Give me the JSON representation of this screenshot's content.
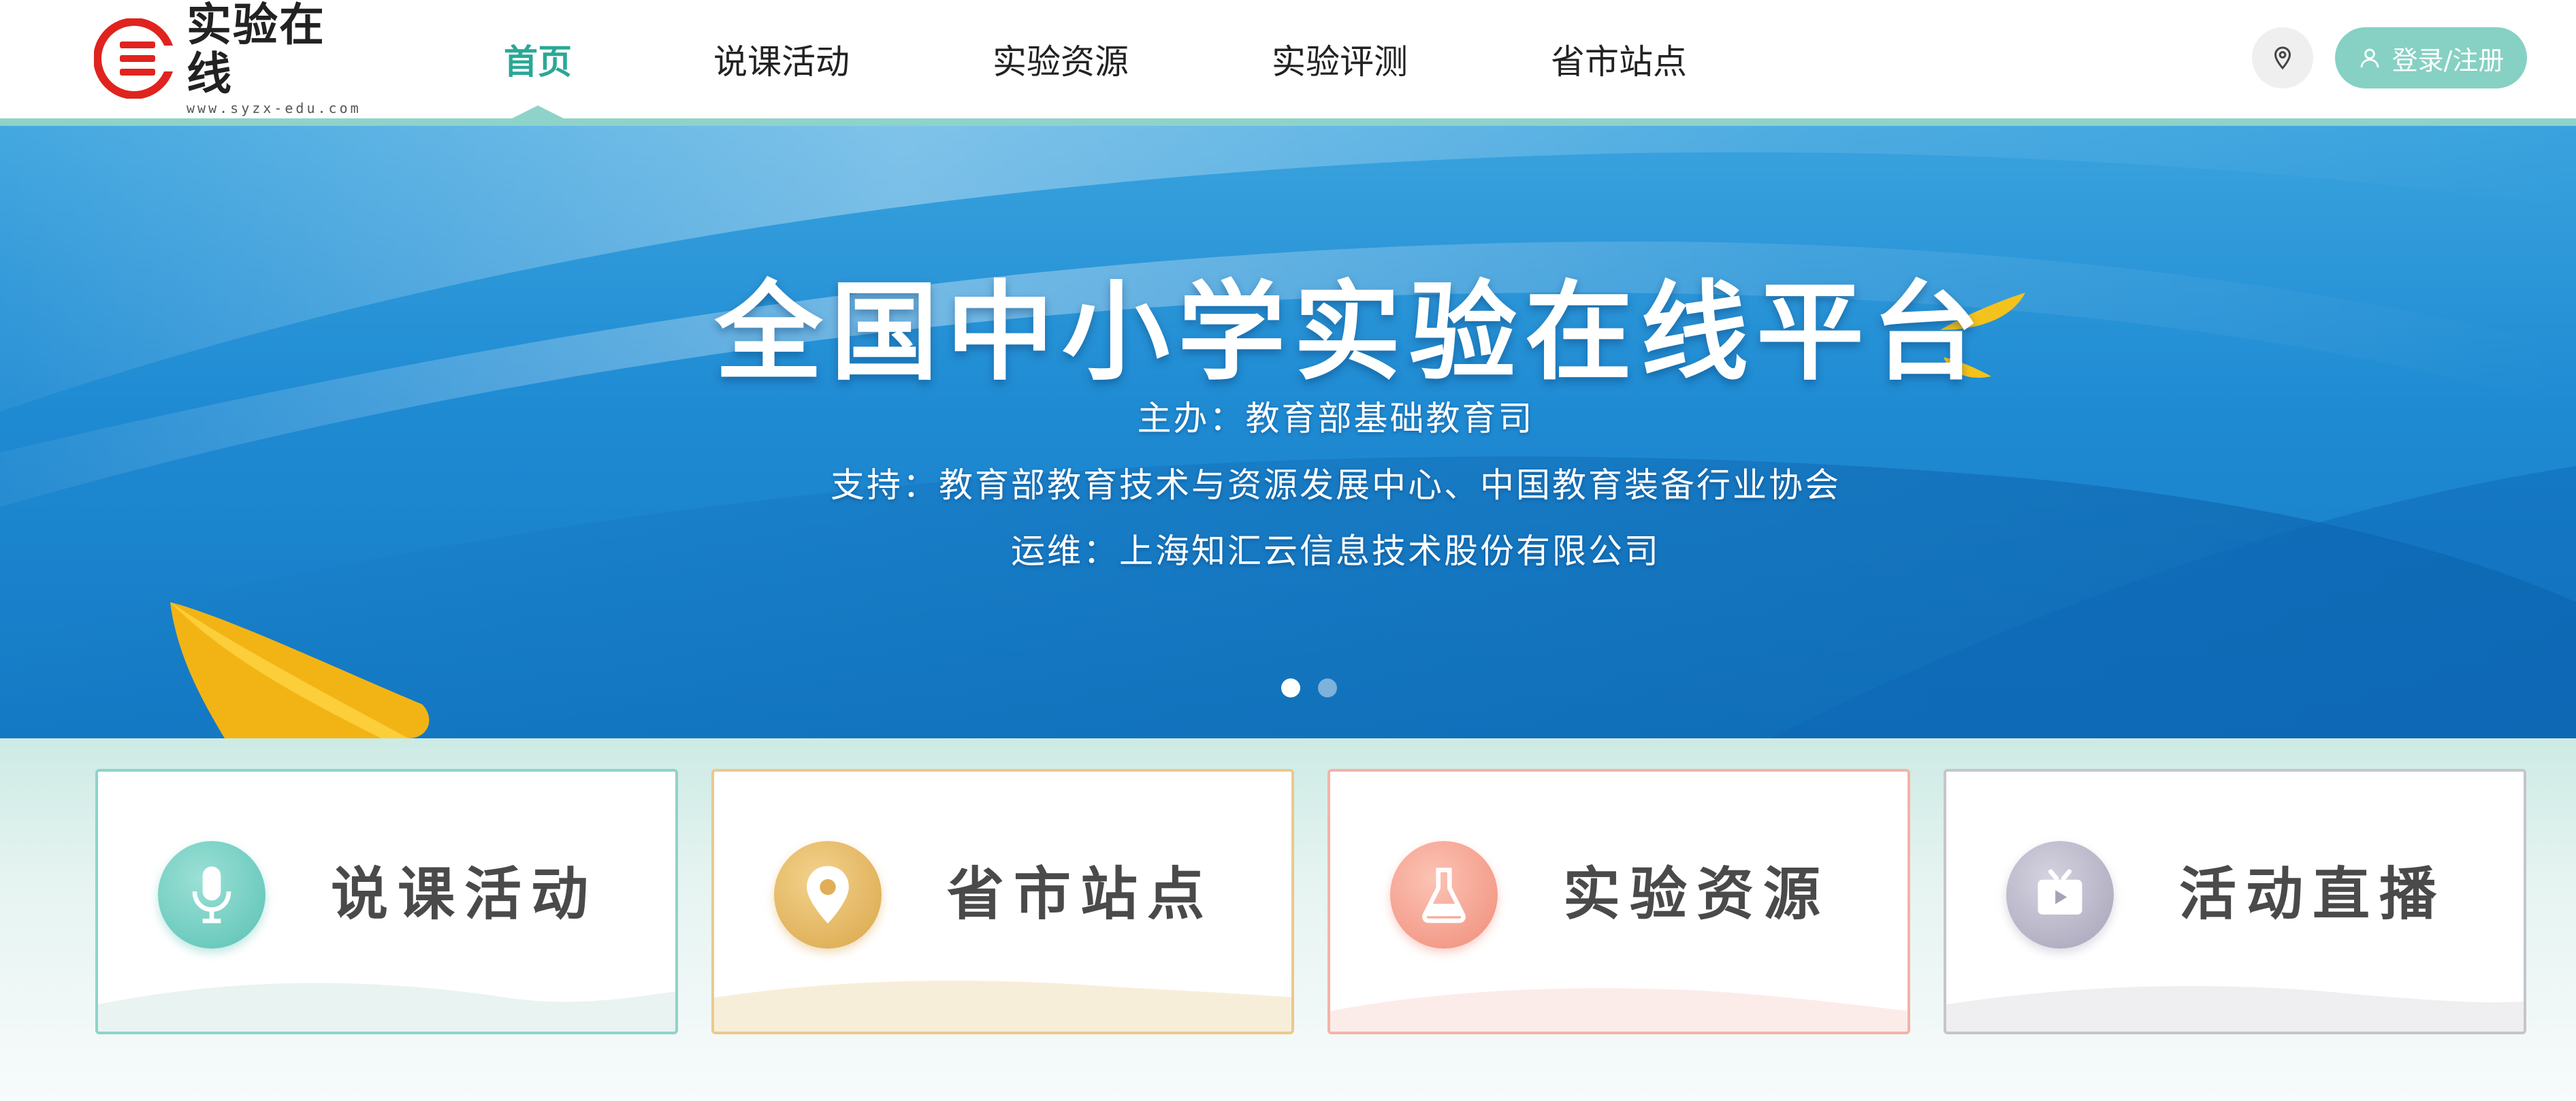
{
  "logo": {
    "title": "实验在线",
    "url": "www.syzx-edu.com",
    "icon": "e-logo-icon"
  },
  "nav": {
    "items": [
      {
        "label": "首页",
        "active": true
      },
      {
        "label": "说课活动",
        "active": false
      },
      {
        "label": "实验资源",
        "active": false
      },
      {
        "label": "实验评测",
        "active": false
      },
      {
        "label": "省市站点",
        "active": false
      }
    ]
  },
  "header_actions": {
    "location_icon": "location-pin-icon",
    "login_icon": "user-icon",
    "login_label": "登录/注册"
  },
  "banner": {
    "title": "全国中小学实验在线平台",
    "organizer": "主办：教育部基础教育司",
    "support": "支持：教育部教育技术与资源发展中心、中国教育装备行业协会",
    "operator": "运维：上海知汇云信息技术股份有限公司",
    "slide_count": 2,
    "active_slide": 1
  },
  "cards": [
    {
      "label": "说课活动",
      "icon": "microphone-icon",
      "color": "#5bc2b4"
    },
    {
      "label": "省市站点",
      "icon": "location-pin-icon",
      "color": "#d9a64a"
    },
    {
      "label": "实验资源",
      "icon": "flask-icon",
      "color": "#f08d7a"
    },
    {
      "label": "活动直播",
      "icon": "tv-play-icon",
      "color": "#a6a3b8"
    }
  ],
  "colors": {
    "accent": "#2aa896",
    "header_line": "#8ed3c9",
    "login_button": "#86d1c3",
    "logo_red": "#e0231e"
  }
}
